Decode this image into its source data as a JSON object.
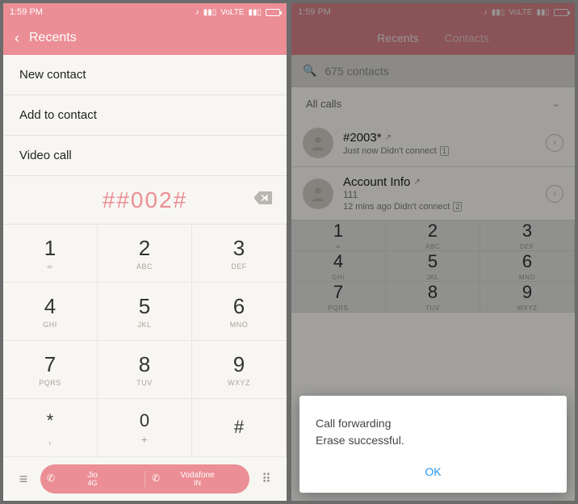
{
  "status": {
    "time": "1:59 PM",
    "volte": "VoLTE"
  },
  "left": {
    "header_title": "Recents",
    "menu": {
      "new_contact": "New contact",
      "add_to_contact": "Add to contact",
      "video_call": "Video call"
    },
    "dialed": "##002#",
    "keypad": {
      "k1": {
        "d": "1",
        "l": "∞"
      },
      "k2": {
        "d": "2",
        "l": "ABC"
      },
      "k3": {
        "d": "3",
        "l": "DEF"
      },
      "k4": {
        "d": "4",
        "l": "GHI"
      },
      "k5": {
        "d": "5",
        "l": "JKL"
      },
      "k6": {
        "d": "6",
        "l": "MNO"
      },
      "k7": {
        "d": "7",
        "l": "PQRS"
      },
      "k8": {
        "d": "8",
        "l": "TUV"
      },
      "k9": {
        "d": "9",
        "l": "WXYZ"
      },
      "kstar": {
        "d": "*",
        "l": ","
      },
      "k0": {
        "d": "0",
        "l": "+"
      },
      "khash": {
        "d": "#",
        "l": ""
      }
    },
    "sim1": {
      "carrier": "Jio",
      "net": "4G"
    },
    "sim2": {
      "carrier": "Vodafone",
      "net": "IN"
    }
  },
  "right": {
    "tabs": {
      "recents": "Recents",
      "contacts": "Contacts"
    },
    "search_placeholder": "675 contacts",
    "filter": "All calls",
    "calls": [
      {
        "name": "#2003*",
        "sub": "Just now Didn't connect",
        "sim": "1"
      },
      {
        "name": "Account Info",
        "num": "111",
        "sub": "12 mins ago Didn't connect",
        "sim": "2"
      }
    ],
    "dialog": {
      "line1": "Call forwarding",
      "line2": "Erase successful.",
      "ok": "OK"
    }
  }
}
